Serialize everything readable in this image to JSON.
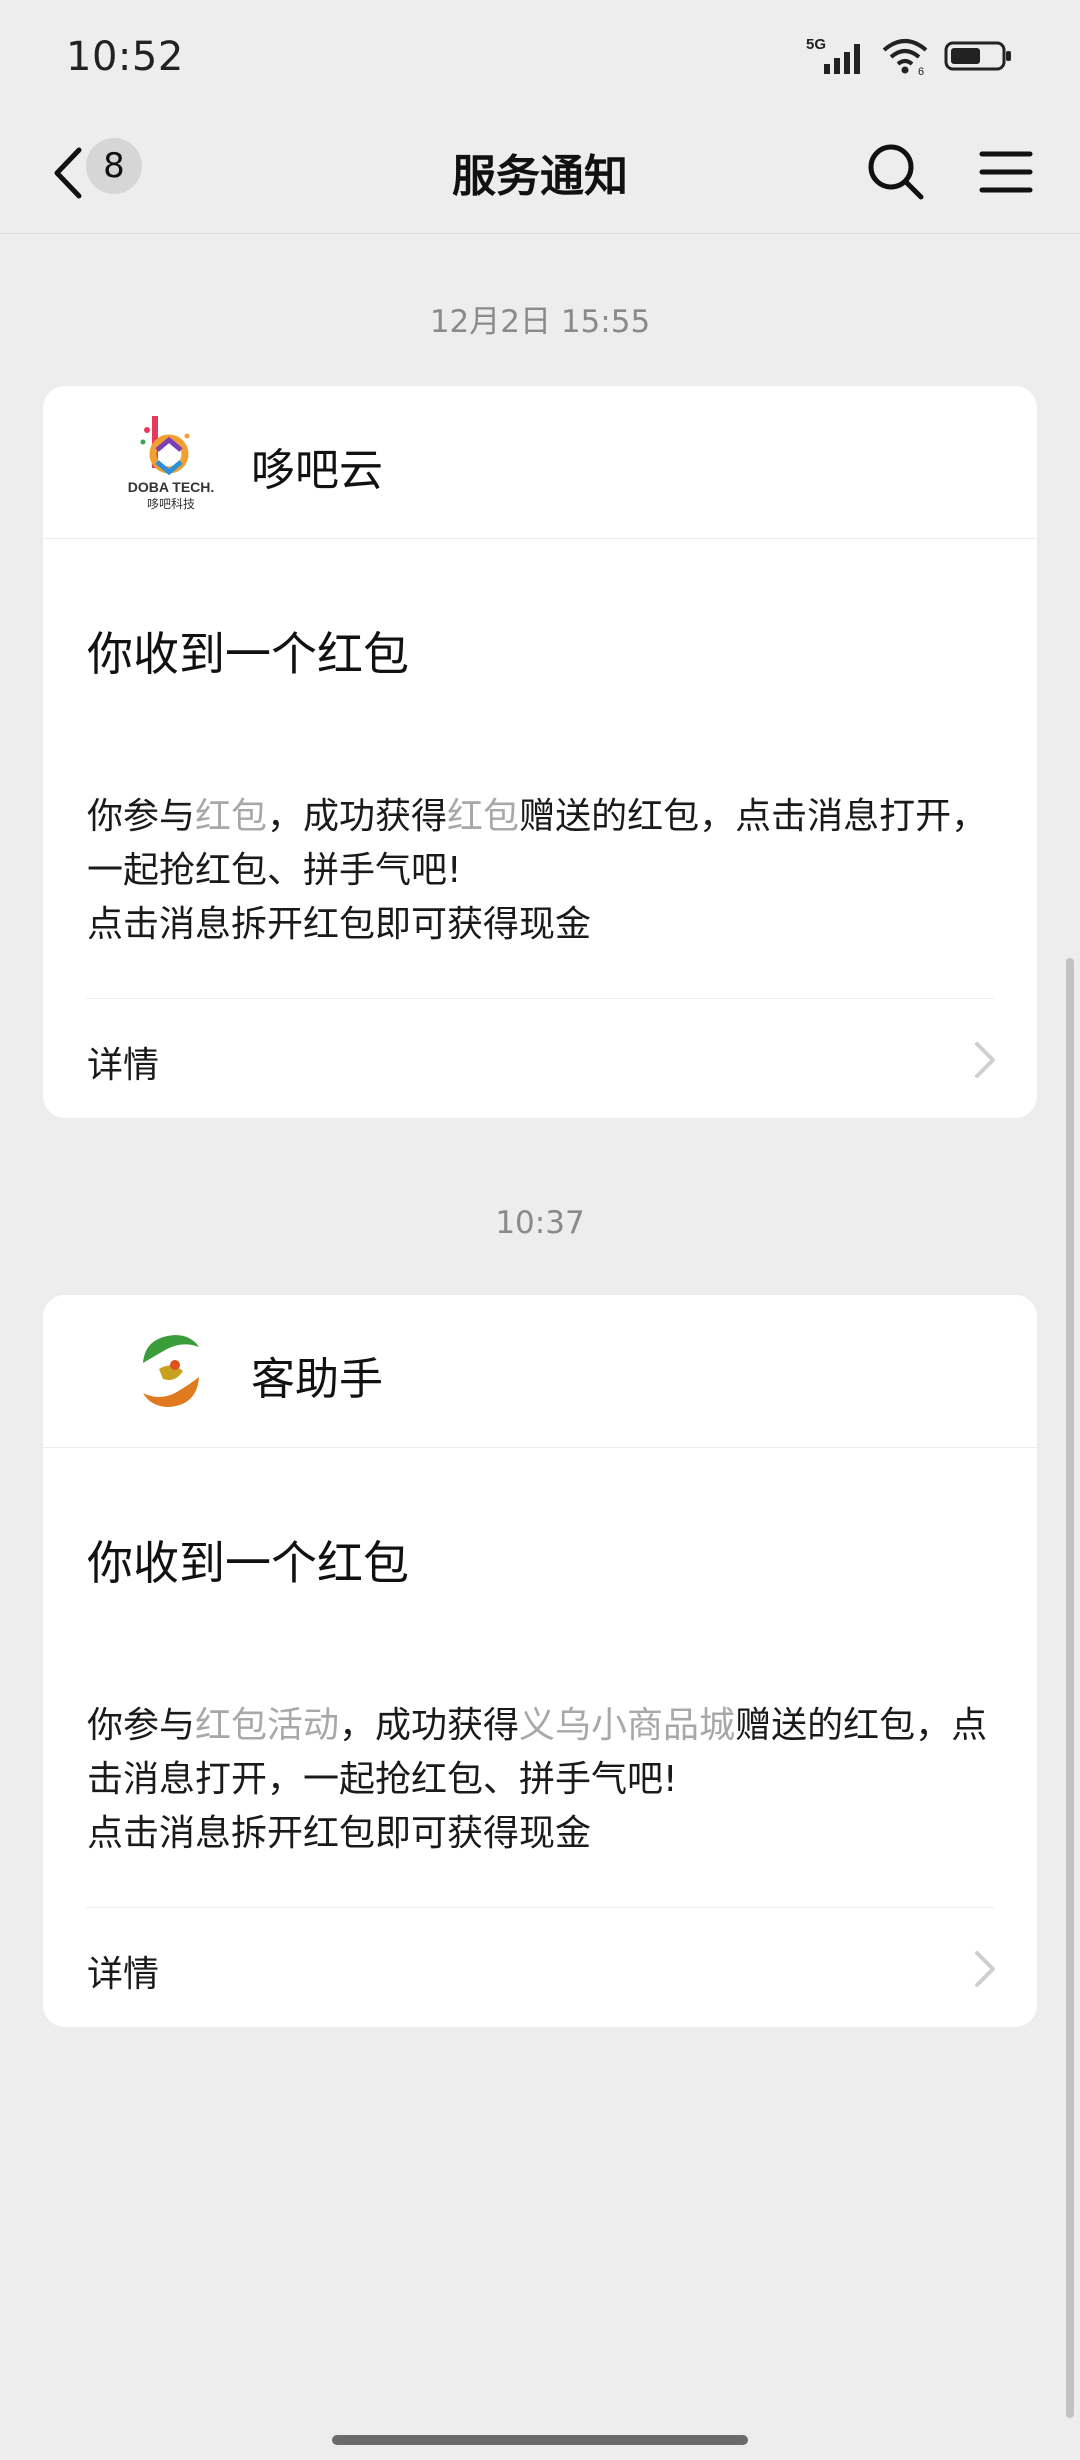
{
  "status_bar": {
    "time": "10:52",
    "network_label": "5G",
    "battery_level_fraction": 0.6
  },
  "nav": {
    "back_count": "8",
    "title": "服务通知",
    "icons": [
      "back-chevron-icon",
      "search-icon",
      "menu-icon"
    ]
  },
  "messages": [
    {
      "time": "12月2日 15:55",
      "sender": "哆吧云",
      "logo_text_en": "DOBA TECH.",
      "logo_text_cn": "哆吧科技",
      "title": "你收到一个红包",
      "body": {
        "p1": "你参与",
        "h1": "红包",
        "p2": "，成功获得",
        "h2": "红包",
        "p3": "赠送的红包，点击消息打开，一起抢红包、拼手气吧!",
        "line2": "点击消息拆开红包即可获得现金"
      },
      "detail_label": "详情"
    },
    {
      "time": "10:37",
      "sender": "客助手",
      "title": "你收到一个红包",
      "body": {
        "p1": "你参与",
        "h1": "红包活动",
        "p2": "，成功获得",
        "h2": "义乌小商品城",
        "p3": "赠送的红包，点击消息打开，一起抢红包、拼手气吧!",
        "line2": "点击消息拆开红包即可获得现金"
      },
      "detail_label": "详情"
    }
  ],
  "colors": {
    "background": "#ededed",
    "card": "#ffffff",
    "highlight_text": "#a8a8a8",
    "muted_text": "#8a8a8a"
  }
}
